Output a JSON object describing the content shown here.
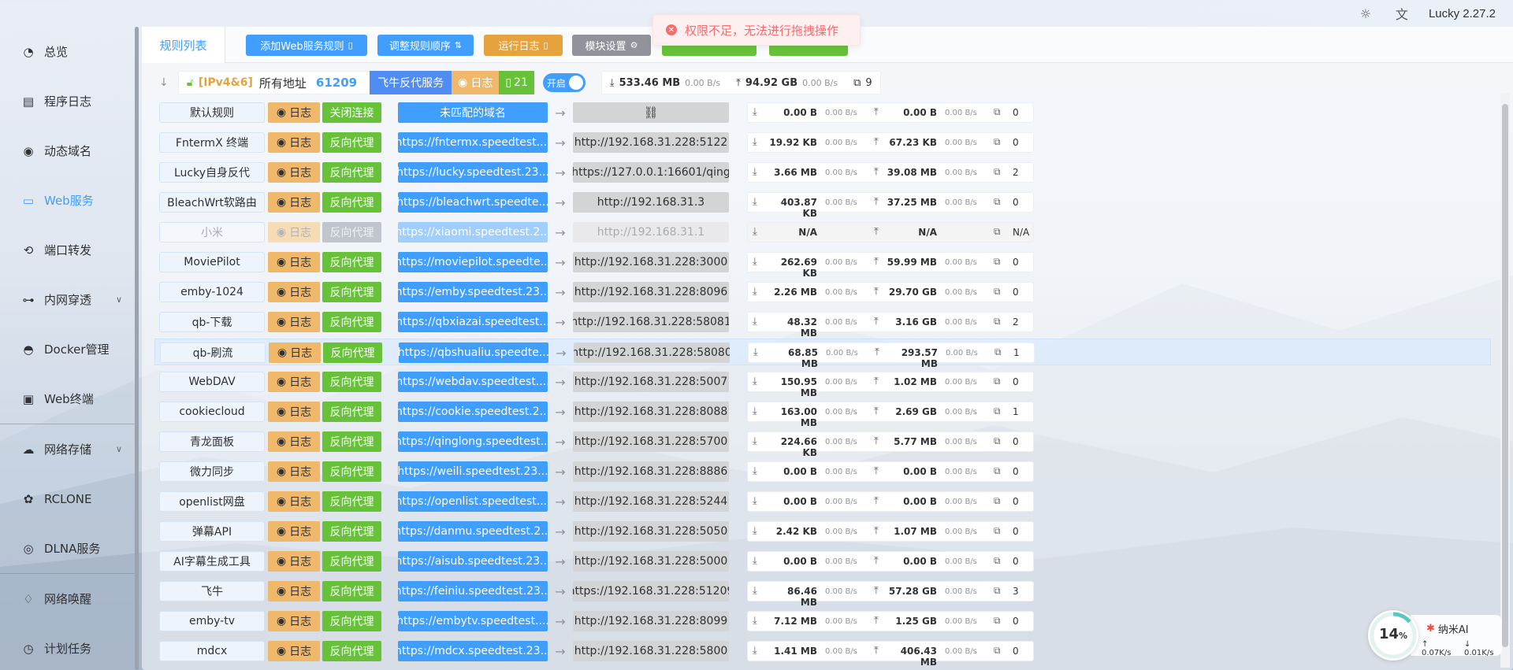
{
  "app": {
    "version": "Lucky 2.27.2",
    "icons": [
      "sun-icon",
      "translate-icon"
    ]
  },
  "sidebar": {
    "items": [
      {
        "label": "总览",
        "icon": "dashboard-icon"
      },
      {
        "label": "程序日志",
        "icon": "log-icon"
      },
      {
        "label": "动态域名",
        "icon": "dns-icon"
      },
      {
        "label": "Web服务",
        "icon": "web-icon",
        "active": true
      },
      {
        "label": "端口转发",
        "icon": "port-icon"
      },
      {
        "label": "内网穿透",
        "icon": "tunnel-icon",
        "expandable": true
      },
      {
        "label": "Docker管理",
        "icon": "docker-icon"
      },
      {
        "label": "Web终端",
        "icon": "terminal-icon"
      },
      {
        "label": "网络存储",
        "icon": "cloud-icon",
        "expandable": true
      },
      {
        "label": "RCLONE",
        "icon": "rclone-icon"
      },
      {
        "label": "DLNA服务",
        "icon": "dlna-icon"
      },
      {
        "label": "网络唤醒",
        "icon": "bell-icon"
      },
      {
        "label": "计划任务",
        "icon": "clock-icon"
      }
    ]
  },
  "tabs": {
    "active": "规则列表"
  },
  "toolbar": {
    "add_rule": "添加Web服务规则",
    "reorder": "调整规则顺序",
    "run_log": "运行日志",
    "module_settings": "模块设置",
    "colors": {
      "blue": "#409eff",
      "orange": "#e6a23c",
      "gray": "#909399",
      "green": "#67c23a"
    }
  },
  "toast": {
    "message": "权限不足，无法进行拖拽操作",
    "color": "#f56c6c"
  },
  "rule": {
    "ip_version": "[IPv4&6]",
    "address": "所有地址",
    "port": "61209",
    "service_type": "飞牛反代服务",
    "log_label": "日志",
    "sub_rule_count": "21",
    "switch_label": "开启",
    "total_down": "533.46 MB",
    "down_speed": "0.00 B/s",
    "total_up": "94.92 GB",
    "up_speed": "0.00 B/s",
    "connections": "9"
  },
  "rows": [
    {
      "name": "默认规则",
      "log": "日志",
      "type": "关闭连接",
      "domain": "未匹配的域名",
      "target": "",
      "down": "0.00 B",
      "down_speed": "0.00 B/s",
      "up": "0.00 B",
      "up_speed": "0.00 B/s",
      "conn": "0"
    },
    {
      "name": "FntermX 终端",
      "log": "日志",
      "type": "反向代理",
      "domain": "https://fntermx.speedtest....",
      "target": "http://192.168.31.228:5122",
      "down": "19.92 KB",
      "down_speed": "0.00 B/s",
      "up": "67.23 KB",
      "up_speed": "0.00 B/s",
      "conn": "0"
    },
    {
      "name": "Lucky自身反代",
      "log": "日志",
      "type": "反向代理",
      "domain": "https://lucky.speedtest.23...",
      "target": "https://127.0.0.1:16601/qing",
      "down": "3.66 MB",
      "down_speed": "0.00 B/s",
      "up": "39.08 MB",
      "up_speed": "0.00 B/s",
      "conn": "2"
    },
    {
      "name": "BleachWrt软路由",
      "log": "日志",
      "type": "反向代理",
      "domain": "https://bleachwrt.speedte...",
      "target": "http://192.168.31.3",
      "down": "403.87 KB",
      "down_speed": "0.00 B/s",
      "up": "37.25 MB",
      "up_speed": "0.00 B/s",
      "conn": "0"
    },
    {
      "name": "小米",
      "log": "日志",
      "type": "反向代理",
      "domain": "https://xiaomi.speedtest.2...",
      "target": "http://192.168.31.1",
      "down": "N/A",
      "down_speed": "",
      "up": "N/A",
      "up_speed": "",
      "conn": "N/A",
      "disabled": true
    },
    {
      "name": "MoviePilot",
      "log": "日志",
      "type": "反向代理",
      "domain": "https://moviepilot.speedte...",
      "target": "http://192.168.31.228:3000",
      "down": "262.69 KB",
      "down_speed": "0.00 B/s",
      "up": "59.99 MB",
      "up_speed": "0.00 B/s",
      "conn": "0"
    },
    {
      "name": "emby-1024",
      "log": "日志",
      "type": "反向代理",
      "domain": "https://emby.speedtest.23...",
      "target": "http://192.168.31.228:8096",
      "down": "2.26 MB",
      "down_speed": "0.00 B/s",
      "up": "29.70 GB",
      "up_speed": "0.00 B/s",
      "conn": "0"
    },
    {
      "name": "qb-下载",
      "log": "日志",
      "type": "反向代理",
      "domain": "https://qbxiazai.speedtest...",
      "target": "http://192.168.31.228:58081",
      "down": "48.32 MB",
      "down_speed": "0.00 B/s",
      "up": "3.16 GB",
      "up_speed": "0.00 B/s",
      "conn": "2"
    },
    {
      "name": "qb-刷流",
      "log": "日志",
      "type": "反向代理",
      "domain": "https://qbshualiu.speedte...",
      "target": "http://192.168.31.228:58080",
      "down": "68.85 MB",
      "down_speed": "0.00 B/s",
      "up": "293.57 MB",
      "up_speed": "0.00 B/s",
      "conn": "1",
      "highlight": true
    },
    {
      "name": "WebDAV",
      "log": "日志",
      "type": "反向代理",
      "domain": "https://webdav.speedtest....",
      "target": "http://192.168.31.228:5007",
      "down": "150.95 MB",
      "down_speed": "0.00 B/s",
      "up": "1.02 MB",
      "up_speed": "0.00 B/s",
      "conn": "0"
    },
    {
      "name": "cookiecloud",
      "log": "日志",
      "type": "反向代理",
      "domain": "https://cookie.speedtest.2...",
      "target": "http://192.168.31.228:8088",
      "down": "163.00 MB",
      "down_speed": "0.00 B/s",
      "up": "2.69 GB",
      "up_speed": "0.00 B/s",
      "conn": "1"
    },
    {
      "name": "青龙面板",
      "log": "日志",
      "type": "反向代理",
      "domain": "https://qinglong.speedtest...",
      "target": "http://192.168.31.228:5700",
      "down": "224.66 KB",
      "down_speed": "0.00 B/s",
      "up": "5.77 MB",
      "up_speed": "0.00 B/s",
      "conn": "0"
    },
    {
      "name": "微力同步",
      "log": "日志",
      "type": "反向代理",
      "domain": "https://weili.speedtest.23...",
      "target": "http://192.168.31.228:8886",
      "down": "0.00 B",
      "down_speed": "0.00 B/s",
      "up": "0.00 B",
      "up_speed": "0.00 B/s",
      "conn": "0"
    },
    {
      "name": "openlist网盘",
      "log": "日志",
      "type": "反向代理",
      "domain": "https://openlist.speedtest....",
      "target": "http://192.168.31.228:5244",
      "down": "0.00 B",
      "down_speed": "0.00 B/s",
      "up": "0.00 B",
      "up_speed": "0.00 B/s",
      "conn": "0"
    },
    {
      "name": "弹幕API",
      "log": "日志",
      "type": "反向代理",
      "domain": "https://danmu.speedtest.2...",
      "target": "http://192.168.31.228:5050",
      "down": "2.42 KB",
      "down_speed": "0.00 B/s",
      "up": "1.07 MB",
      "up_speed": "0.00 B/s",
      "conn": "0"
    },
    {
      "name": "AI字幕生成工具",
      "log": "日志",
      "type": "反向代理",
      "domain": "https://aisub.speedtest.23...",
      "target": "http://192.168.31.228:5000",
      "down": "0.00 B",
      "down_speed": "0.00 B/s",
      "up": "0.00 B",
      "up_speed": "0.00 B/s",
      "conn": "0"
    },
    {
      "name": "飞牛",
      "log": "日志",
      "type": "反向代理",
      "domain": "https://feiniu.speedtest.23...",
      "target": "https://192.168.31.228:51209",
      "down": "86.46 MB",
      "down_speed": "0.00 B/s",
      "up": "57.28 GB",
      "up_speed": "0.00 B/s",
      "conn": "3"
    },
    {
      "name": "emby-tv",
      "log": "日志",
      "type": "反向代理",
      "domain": "https://embytv.speedtest....",
      "target": "http://192.168.31.228:8099",
      "down": "7.12 MB",
      "down_speed": "0.00 B/s",
      "up": "1.25 GB",
      "up_speed": "0.00 B/s",
      "conn": "0"
    },
    {
      "name": "mdcx",
      "log": "日志",
      "type": "反向代理",
      "domain": "https://mdcx.speedtest.23...",
      "target": "http://192.168.31.228:5800",
      "down": "1.41 MB",
      "down_speed": "0.00 B/s",
      "up": "406.43 MB",
      "up_speed": "0.00 B/s",
      "conn": "0"
    }
  ],
  "widget": {
    "percent": "14",
    "percent_unit": "%",
    "brand": "纳米AI",
    "up_speed": "0.07K/s",
    "down_speed": "0.01K/s"
  }
}
